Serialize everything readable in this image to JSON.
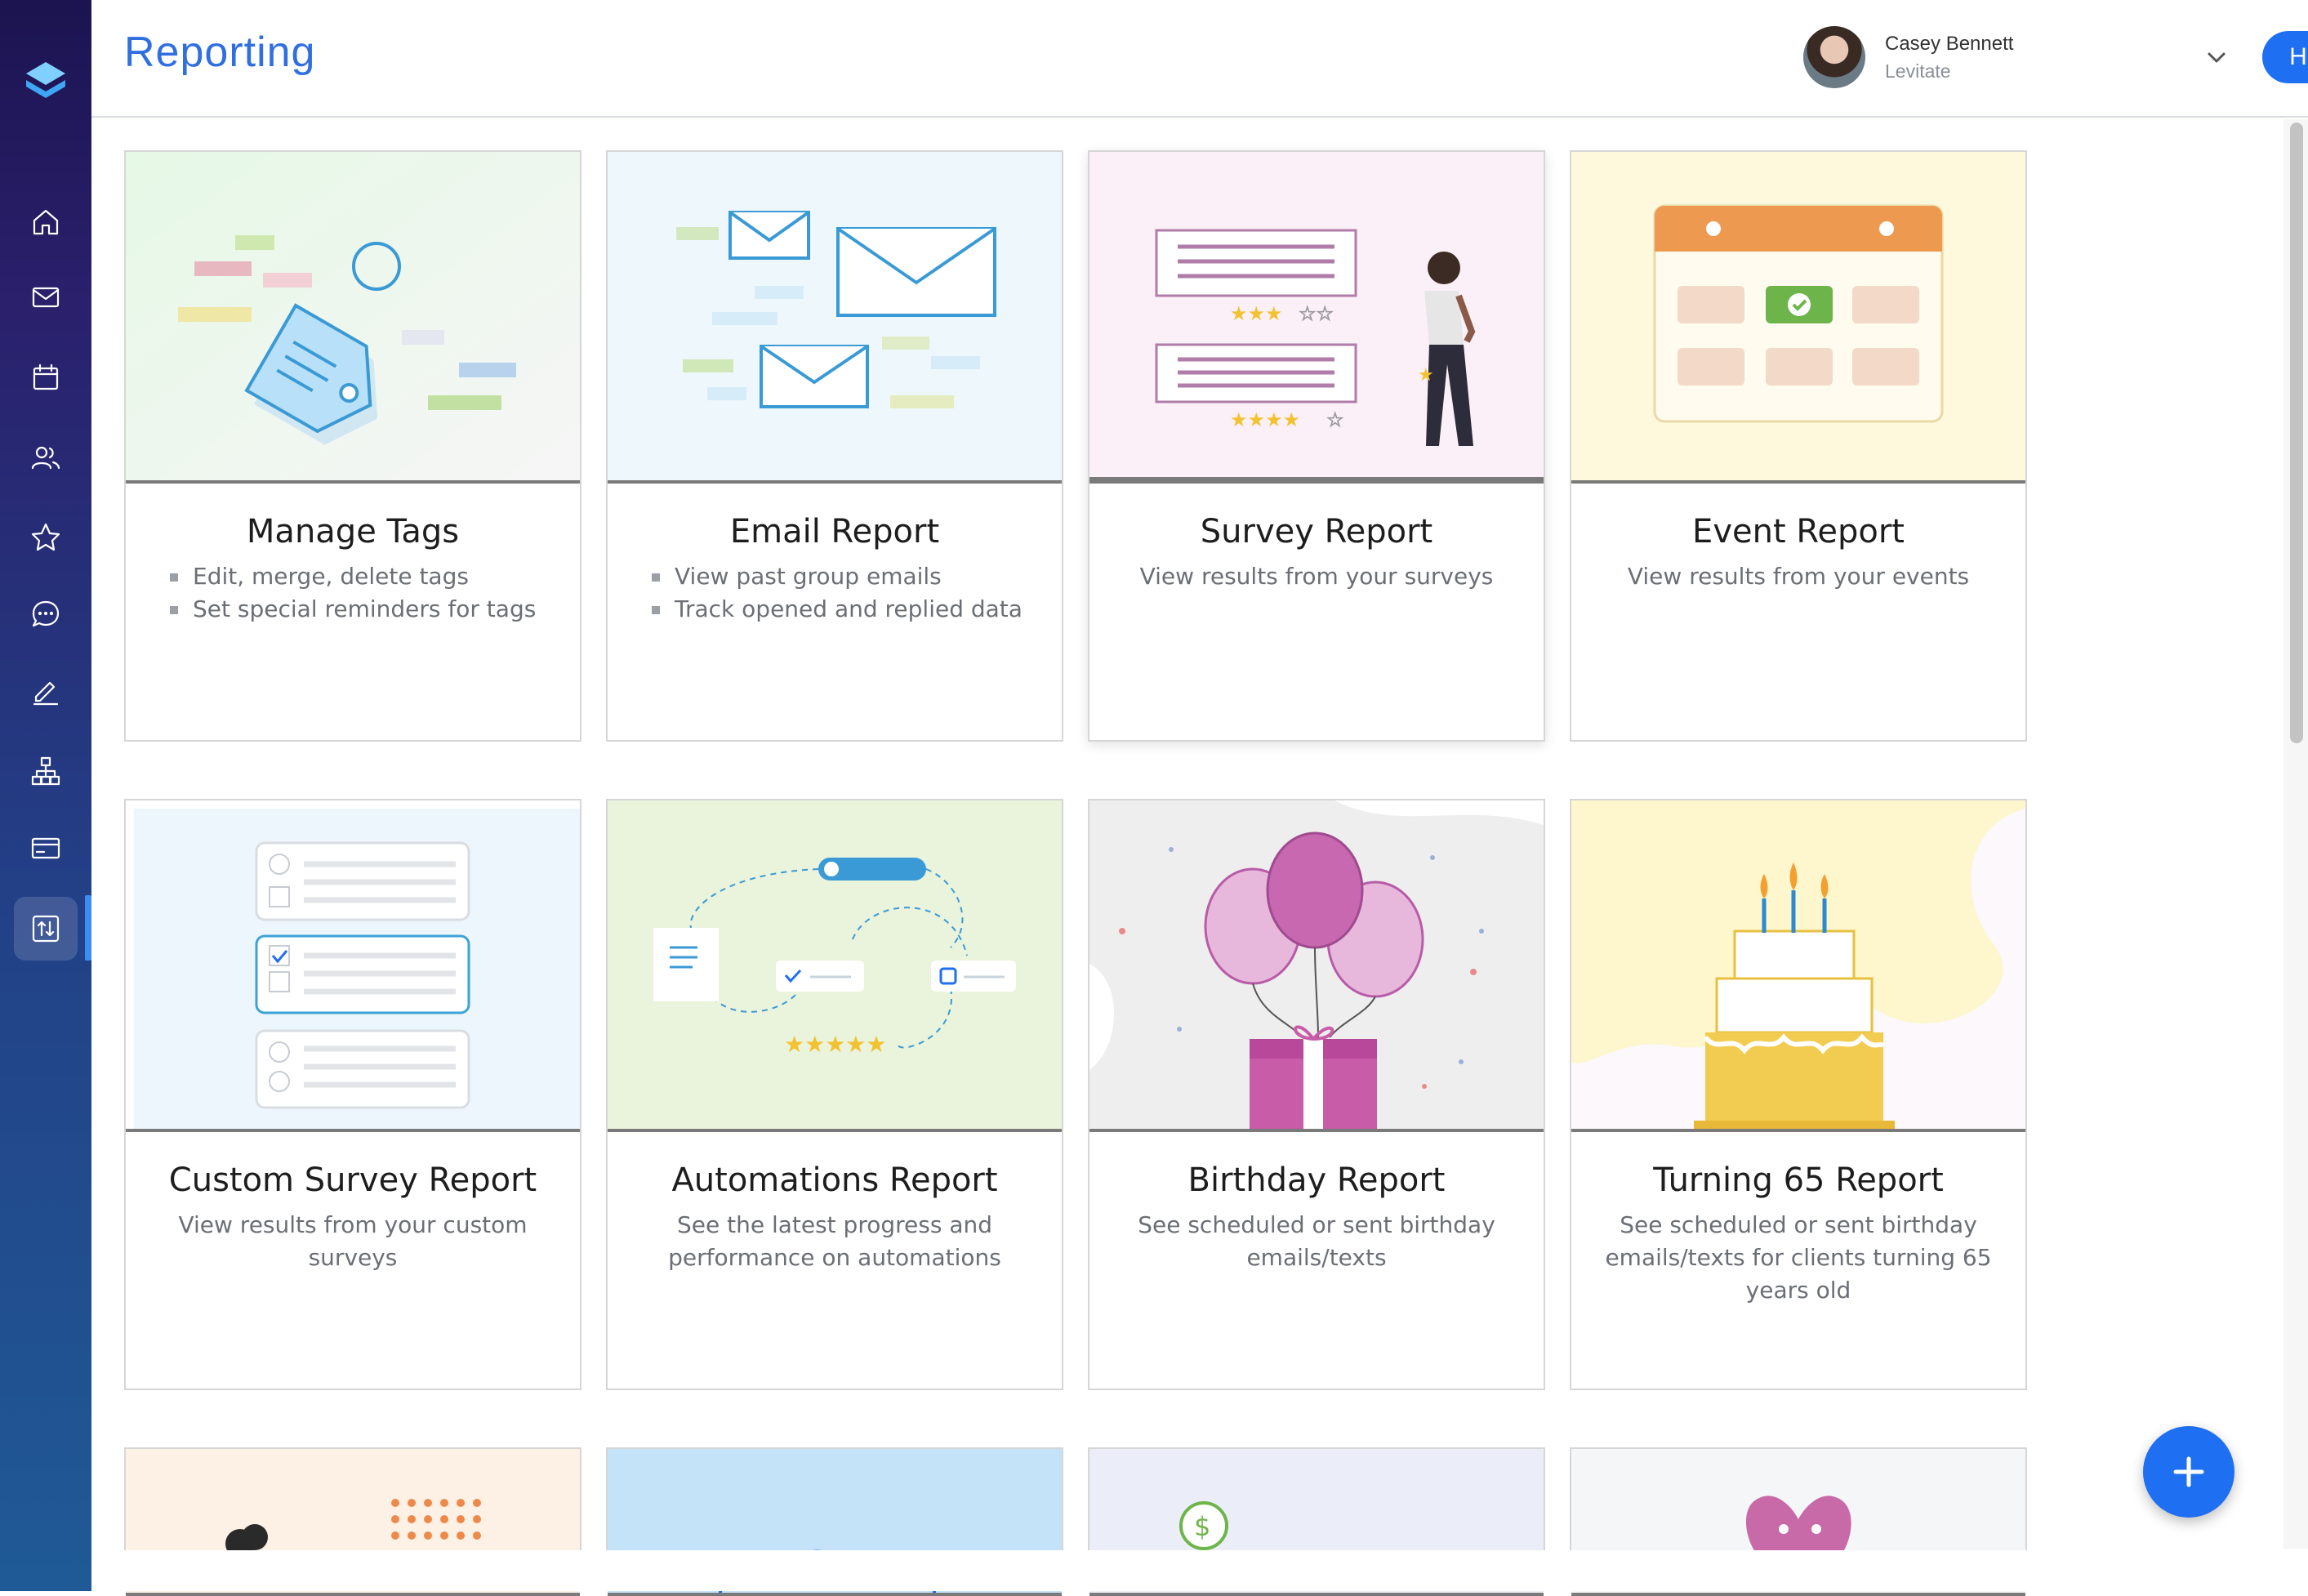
{
  "header": {
    "title": "Reporting",
    "user_name": "Casey Bennett",
    "user_org": "Levitate",
    "help_label": "Help"
  },
  "sidebar": {
    "items": [
      {
        "icon": "home-icon"
      },
      {
        "icon": "mail-icon"
      },
      {
        "icon": "calendar-icon"
      },
      {
        "icon": "users-icon"
      },
      {
        "icon": "star-icon"
      },
      {
        "icon": "chat-icon"
      },
      {
        "icon": "edit-icon"
      },
      {
        "icon": "org-chart-icon"
      },
      {
        "icon": "card-icon"
      },
      {
        "icon": "reporting-icon",
        "active": true
      }
    ]
  },
  "cards": [
    {
      "title": "Manage Tags",
      "bullets": [
        "Edit, merge, delete tags",
        "Set special reminders for tags"
      ]
    },
    {
      "title": "Email Report",
      "bullets": [
        "View past group emails",
        "Track opened and replied data"
      ]
    },
    {
      "title": "Survey Report",
      "desc": "View results from your surveys"
    },
    {
      "title": "Event Report",
      "desc": "View results from your events"
    },
    {
      "title": "Custom Survey Report",
      "desc": "View results from your custom surveys"
    },
    {
      "title": "Automations Report",
      "desc": "See the latest progress and performance on automations"
    },
    {
      "title": "Birthday Report",
      "desc": "See scheduled or sent birthday emails/texts"
    },
    {
      "title": "Turning 65 Report",
      "desc": "See scheduled or sent birthday emails/texts for clients turning 65 years old"
    }
  ],
  "colors": {
    "accent": "#1f6ff2",
    "title_blue": "#2f6fe0",
    "sidebar_top": "#1b1450",
    "sidebar_bottom": "#1f5a96"
  }
}
